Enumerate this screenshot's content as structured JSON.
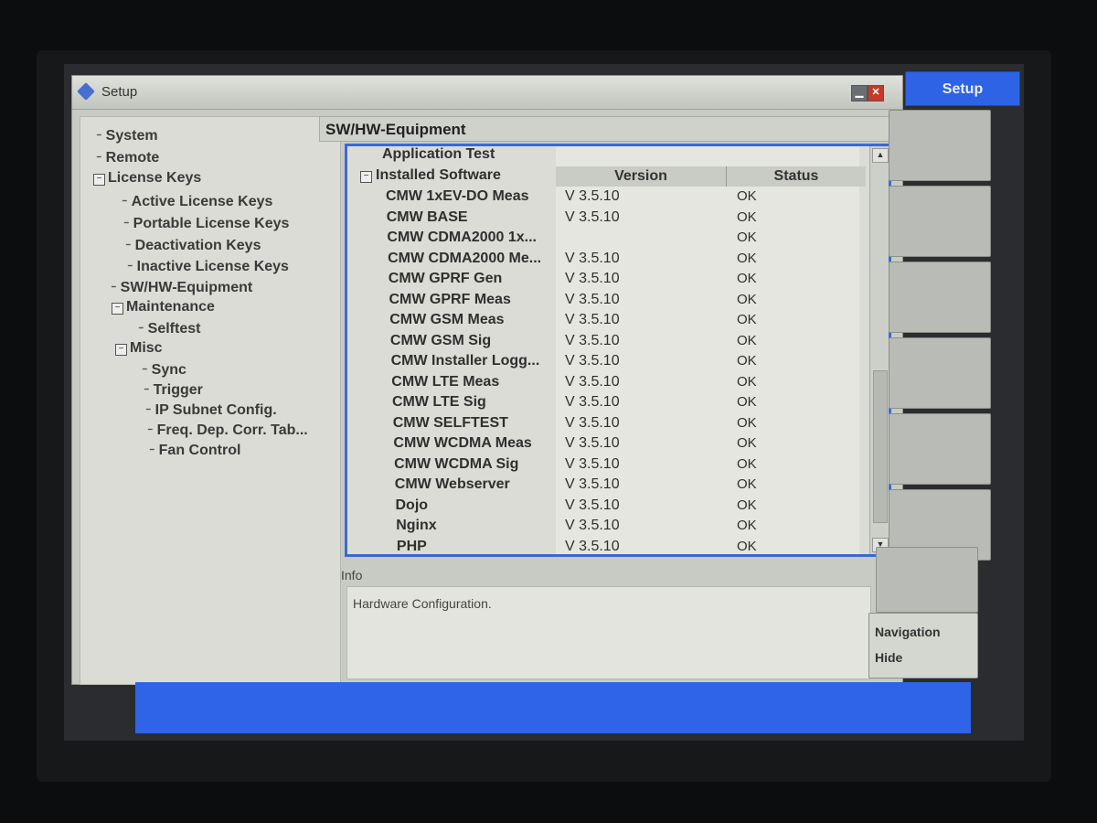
{
  "window": {
    "title": "Setup"
  },
  "tree": [
    {
      "label": "System"
    },
    {
      "label": "Remote"
    },
    {
      "label": "License Keys"
    },
    {
      "label": "Active License Keys"
    },
    {
      "label": "Portable License Keys"
    },
    {
      "label": "Deactivation Keys"
    },
    {
      "label": "Inactive License Keys"
    },
    {
      "label": "SW/HW-Equipment"
    },
    {
      "label": "Maintenance"
    },
    {
      "label": "Selftest"
    },
    {
      "label": "Misc"
    },
    {
      "label": "Sync"
    },
    {
      "label": "Trigger"
    },
    {
      "label": "IP Subnet Config."
    },
    {
      "label": "Freq. Dep. Corr. Tab..."
    },
    {
      "label": "Fan Control"
    }
  ],
  "panel": {
    "title": "SW/HW-Equipment",
    "partial_top_item": "Application Test",
    "group": "Installed Software",
    "columns": {
      "version": "Version",
      "status": "Status"
    },
    "rows": [
      {
        "name": "CMW 1xEV-DO Meas",
        "version": "V 3.5.10",
        "status": "OK"
      },
      {
        "name": "CMW BASE",
        "version": "V 3.5.10",
        "status": "OK"
      },
      {
        "name": "CMW CDMA2000 1x...",
        "version": "",
        "status": "OK"
      },
      {
        "name": "CMW CDMA2000 Me...",
        "version": "V 3.5.10",
        "status": "OK"
      },
      {
        "name": "CMW GPRF Gen",
        "version": "V 3.5.10",
        "status": "OK"
      },
      {
        "name": "CMW GPRF Meas",
        "version": "V 3.5.10",
        "status": "OK"
      },
      {
        "name": "CMW GSM Meas",
        "version": "V 3.5.10",
        "status": "OK"
      },
      {
        "name": "CMW GSM Sig",
        "version": "V 3.5.10",
        "status": "OK"
      },
      {
        "name": "CMW Installer Logg...",
        "version": "V 3.5.10",
        "status": "OK"
      },
      {
        "name": "CMW LTE Meas",
        "version": "V 3.5.10",
        "status": "OK"
      },
      {
        "name": "CMW LTE Sig",
        "version": "V 3.5.10",
        "status": "OK"
      },
      {
        "name": "CMW SELFTEST",
        "version": "V 3.5.10",
        "status": "OK"
      },
      {
        "name": "CMW WCDMA Meas",
        "version": "V 3.5.10",
        "status": "OK"
      },
      {
        "name": "CMW WCDMA Sig",
        "version": "V 3.5.10",
        "status": "OK"
      },
      {
        "name": "CMW Webserver",
        "version": "V 3.5.10",
        "status": "OK"
      },
      {
        "name": "Dojo",
        "version": "V 3.5.10",
        "status": "OK"
      },
      {
        "name": "Nginx",
        "version": "V 3.5.10",
        "status": "OK"
      },
      {
        "name": "PHP",
        "version": "V 3.5.10",
        "status": "OK"
      }
    ]
  },
  "info": {
    "label": "Info",
    "text": "Hardware Configuration."
  },
  "softkeys": {
    "title": "Setup",
    "nav_line1": "Navigation",
    "nav_line2": "Hide"
  },
  "colors": {
    "accent": "#2f63e8",
    "list_border": "#3b68d8"
  }
}
